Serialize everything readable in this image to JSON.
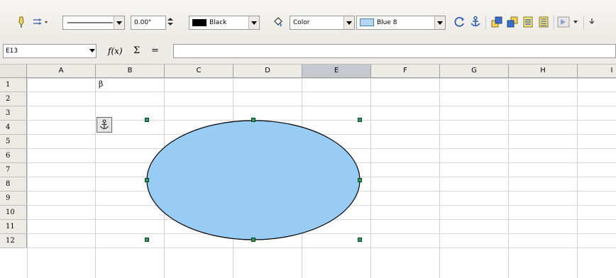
{
  "toolbar": {
    "line_width": "0.00\"",
    "line_color": "Black",
    "line_color_swatch": "#000000",
    "area_style": "Color",
    "area_fill": "Blue 8",
    "area_fill_swatch": "#b5d6f2"
  },
  "formula_bar": {
    "cell_reference": "E13",
    "function_wizard": "f(x)",
    "sum": "Σ",
    "function": "="
  },
  "sheet": {
    "columns": [
      "A",
      "B",
      "C",
      "D",
      "E",
      "F",
      "G",
      "H",
      "I"
    ],
    "selected_column": "E",
    "rows": [
      "1",
      "2",
      "3",
      "4",
      "5",
      "6",
      "7",
      "8",
      "9",
      "10",
      "11",
      "12"
    ],
    "cell_b1": "β"
  },
  "shape": {
    "type": "ellipse",
    "fill": "#99ccf5",
    "stroke": "#000000"
  }
}
